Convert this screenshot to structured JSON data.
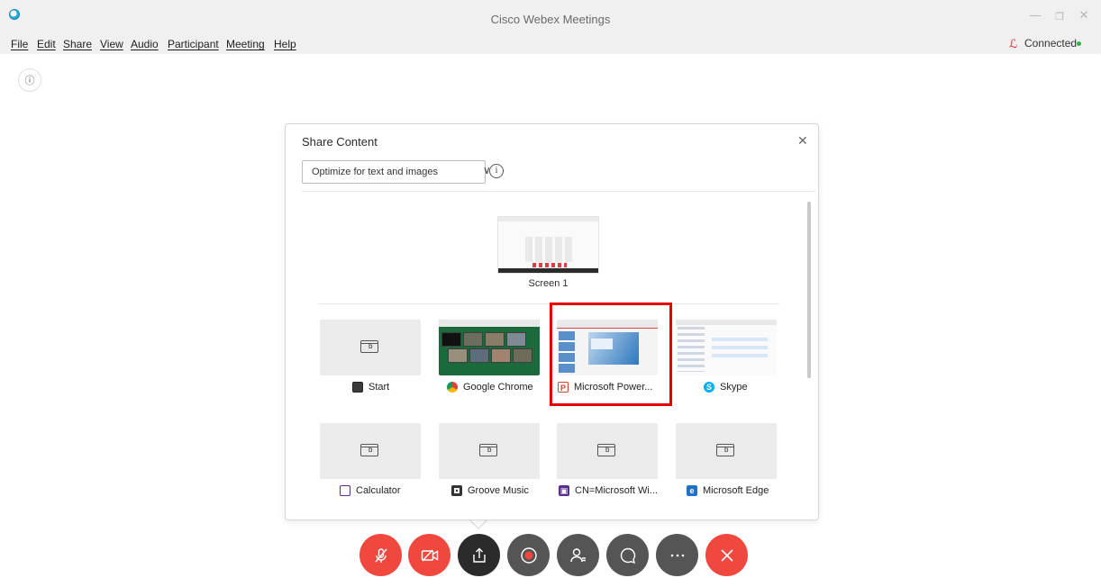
{
  "window": {
    "title": "Cisco Webex Meetings",
    "minimize": "—",
    "restore": "❐",
    "close": "✕"
  },
  "menu": [
    {
      "label": "File"
    },
    {
      "label": "Edit"
    },
    {
      "label": "Share"
    },
    {
      "label": "View"
    },
    {
      "label": "Audio"
    },
    {
      "label": "Participant"
    },
    {
      "label": "Meeting"
    },
    {
      "label": "Help"
    }
  ],
  "status": {
    "connected_label": "Connected",
    "connected_color": "#2fb34a"
  },
  "dialog": {
    "title": "Share Content",
    "optimize_option": "Optimize for text and images",
    "screens": [
      {
        "label": "Screen 1"
      }
    ],
    "apps": [
      {
        "label": "Start",
        "icon": "start-icon"
      },
      {
        "label": "Google Chrome",
        "icon": "chrome-icon"
      },
      {
        "label": "Microsoft Power...",
        "icon": "powerpoint-icon"
      },
      {
        "label": "Skype",
        "icon": "skype-icon"
      },
      {
        "label": "Calculator",
        "icon": "calculator-icon"
      },
      {
        "label": "Groove Music",
        "icon": "groove-music-icon"
      },
      {
        "label": "CN=Microsoft Wi...",
        "icon": "app-installer-icon"
      },
      {
        "label": "Microsoft Edge",
        "icon": "edge-icon"
      }
    ],
    "highlighted_app": "Microsoft Power..."
  },
  "controls": [
    {
      "name": "mute-button",
      "icon": "microphone-muted-icon"
    },
    {
      "name": "video-button",
      "icon": "video-off-icon"
    },
    {
      "name": "share-button",
      "icon": "share-icon"
    },
    {
      "name": "record-button",
      "icon": "record-icon"
    },
    {
      "name": "participants-button",
      "icon": "participants-icon"
    },
    {
      "name": "chat-button",
      "icon": "chat-icon"
    },
    {
      "name": "more-button",
      "icon": "more-icon"
    },
    {
      "name": "leave-button",
      "icon": "close-icon"
    }
  ],
  "colors": {
    "accent_red": "#f0483e",
    "highlight_border": "#e60000",
    "control_dark": "#555555"
  }
}
